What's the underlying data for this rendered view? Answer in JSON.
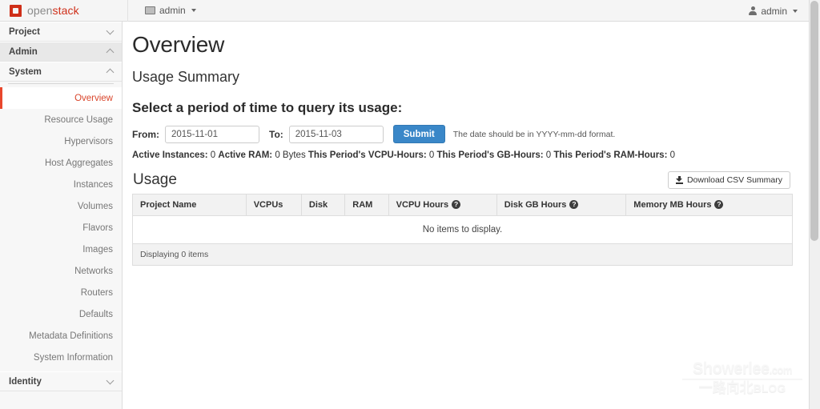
{
  "topbar": {
    "logo": {
      "open": "open",
      "stack": "stack",
      "icon": "openstack-logo-icon"
    },
    "project_selector": {
      "label": "admin",
      "icon": "monitor-icon"
    },
    "user_menu": {
      "label": "admin",
      "icon": "person-icon"
    }
  },
  "sidebar": {
    "sections": [
      {
        "label": "Project",
        "expanded": false
      },
      {
        "label": "Admin",
        "expanded": true
      },
      {
        "label": "System",
        "expanded": true
      }
    ],
    "items": [
      {
        "label": "Overview",
        "active": true
      },
      {
        "label": "Resource Usage",
        "active": false
      },
      {
        "label": "Hypervisors",
        "active": false
      },
      {
        "label": "Host Aggregates",
        "active": false
      },
      {
        "label": "Instances",
        "active": false
      },
      {
        "label": "Volumes",
        "active": false
      },
      {
        "label": "Flavors",
        "active": false
      },
      {
        "label": "Images",
        "active": false
      },
      {
        "label": "Networks",
        "active": false
      },
      {
        "label": "Routers",
        "active": false
      },
      {
        "label": "Defaults",
        "active": false
      },
      {
        "label": "Metadata Definitions",
        "active": false
      },
      {
        "label": "System Information",
        "active": false
      }
    ],
    "identity": {
      "label": "Identity",
      "expanded": false
    }
  },
  "main": {
    "page_title": "Overview",
    "sub_title": "Usage Summary",
    "prompt": "Select a period of time to query its usage:",
    "form": {
      "from_label": "From:",
      "from_value": "2015-11-01",
      "to_label": "To:",
      "to_value": "2015-11-03",
      "submit_label": "Submit",
      "hint": "The date should be in YYYY-mm-dd format."
    },
    "stats": [
      {
        "label": "Active Instances:",
        "value": "0"
      },
      {
        "label": "Active RAM:",
        "value": "0 Bytes"
      },
      {
        "label": "This Period's VCPU-Hours:",
        "value": "0"
      },
      {
        "label": "This Period's GB-Hours:",
        "value": "0"
      },
      {
        "label": "This Period's RAM-Hours:",
        "value": "0"
      }
    ],
    "usage_panel": {
      "title": "Usage",
      "csv_button": "Download CSV Summary",
      "columns": [
        {
          "label": "Project Name",
          "help": false
        },
        {
          "label": "VCPUs",
          "help": false
        },
        {
          "label": "Disk",
          "help": false
        },
        {
          "label": "RAM",
          "help": false
        },
        {
          "label": "VCPU Hours",
          "help": true
        },
        {
          "label": "Disk GB Hours",
          "help": true
        },
        {
          "label": "Memory MB Hours",
          "help": true
        }
      ],
      "help_glyph": "?",
      "empty_message": "No items to display.",
      "footer": "Displaying 0 items"
    }
  },
  "watermark": {
    "line1": "Showerlee",
    "line1_suffix": ".com",
    "line2_cn": "一路向北",
    "line2_en": "BLOG"
  },
  "colors": {
    "accent_red": "#e8472c",
    "brand_red": "#cf2f19",
    "submit_blue": "#3a87c8",
    "sidebar_bg": "#f7f7f7"
  }
}
